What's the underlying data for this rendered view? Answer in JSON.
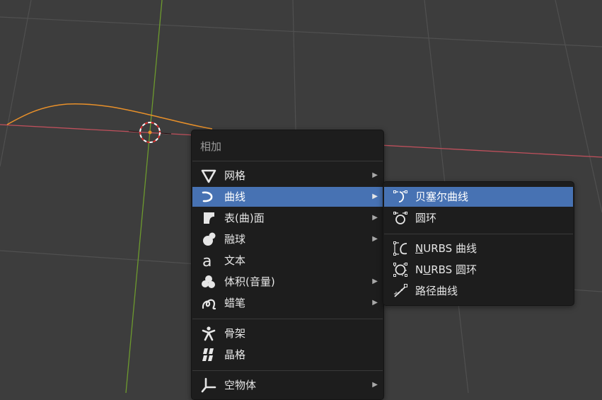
{
  "colors": {
    "viewport_bg": "#3d3d3d",
    "grid_line": "#505050",
    "x_axis": "#c0505c",
    "y_axis": "#6d9a2e",
    "curve": "#e8902a",
    "menu_bg": "#1d1d1d",
    "highlight": "#4772b3"
  },
  "add_menu": {
    "title": "相加",
    "items": [
      {
        "label": "网格",
        "icon": "mesh-icon",
        "has_submenu": true
      },
      {
        "label": "曲线",
        "icon": "curve-icon",
        "has_submenu": true,
        "highlighted": true
      },
      {
        "label": "表(曲)面",
        "icon": "surface-icon",
        "has_submenu": true
      },
      {
        "label": "融球",
        "icon": "metaball-icon",
        "has_submenu": true
      },
      {
        "label": "文本",
        "icon": "text-icon",
        "has_submenu": false
      },
      {
        "label": "体积(音量)",
        "icon": "volume-icon",
        "has_submenu": true
      },
      {
        "label": "蜡笔",
        "icon": "grease-pencil-icon",
        "has_submenu": true
      },
      {
        "label": "骨架",
        "icon": "armature-icon",
        "has_submenu": false
      },
      {
        "label": "晶格",
        "icon": "lattice-icon",
        "has_submenu": false
      },
      {
        "label": "空物体",
        "icon": "empty-icon",
        "has_submenu": true
      }
    ],
    "submenu_arrow": "▶"
  },
  "curve_submenu": {
    "items": [
      {
        "label": "贝塞尔曲线",
        "icon": "bezier-curve-icon",
        "highlighted": true
      },
      {
        "label": "圆环",
        "icon": "bezier-circle-icon"
      },
      {
        "label_underlined": "N",
        "label_rest": "URBS 曲线",
        "icon": "nurbs-curve-icon"
      },
      {
        "label_pre": "N",
        "label_underlined": "U",
        "label_rest": "RBS 圆环",
        "icon": "nurbs-circle-icon"
      },
      {
        "label": "路径曲线",
        "icon": "path-curve-icon"
      }
    ]
  }
}
